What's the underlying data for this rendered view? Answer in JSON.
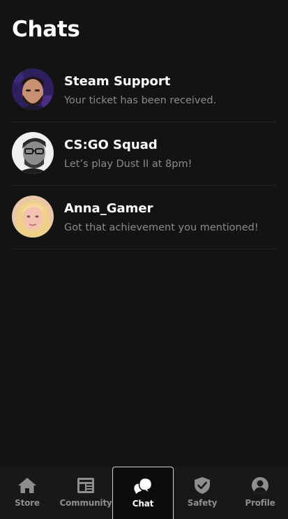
{
  "header": {
    "title": "Chats"
  },
  "chats": [
    {
      "name": "Steam Support",
      "preview": "Your ticket has been received.",
      "avatar": "avatar-man-bearded-purple-bg"
    },
    {
      "name": "CS:GO Squad",
      "preview": "Let’s play Dust II at 8pm!",
      "avatar": "avatar-man-glasses-grayscale"
    },
    {
      "name": "Anna_Gamer",
      "preview": "Got that achievement you mentioned!",
      "avatar": "avatar-woman-blonde"
    }
  ],
  "nav": {
    "items": [
      {
        "label": "Store",
        "icon": "home-icon"
      },
      {
        "label": "Community",
        "icon": "newspaper-icon"
      },
      {
        "label": "Chat",
        "icon": "chat-bubbles-icon",
        "active": true
      },
      {
        "label": "Safety",
        "icon": "shield-check-icon"
      },
      {
        "label": "Profile",
        "icon": "user-circle-icon"
      }
    ]
  },
  "colors": {
    "background": "#131313",
    "nav_background": "#181818",
    "text_primary": "#ffffff",
    "text_secondary": "#8a8a8a",
    "nav_inactive": "#8e8e8e",
    "divider": "#232323"
  }
}
